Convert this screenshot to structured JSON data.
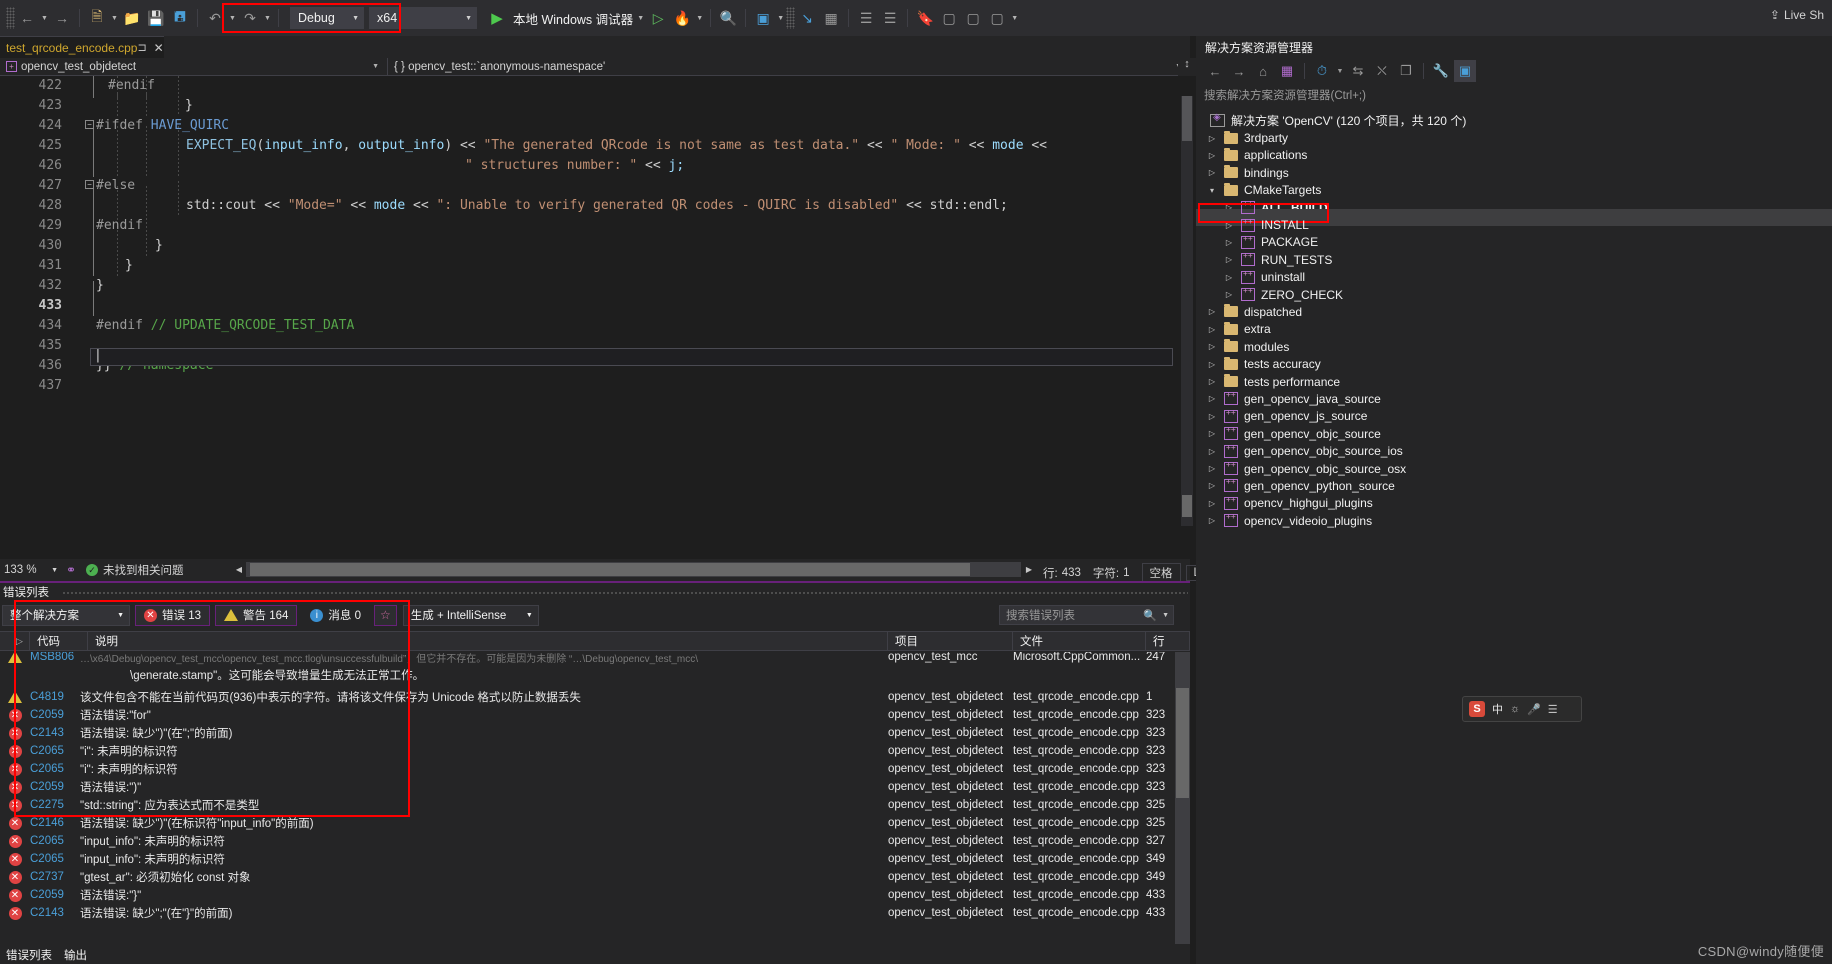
{
  "toolbar": {
    "config": "Debug",
    "platform": "x64",
    "debugger_label": "本地 Windows 调试器",
    "live_share": "Live Sh",
    "icons": [
      "back-icon",
      "forward-icon",
      "new-item-icon",
      "open-file-icon",
      "save-icon",
      "save-all-icon",
      "undo-icon",
      "redo-icon",
      "start-icon",
      "attach-icon",
      "hot-reload-icon",
      "solution-config-icon",
      "window-layout-icon",
      "find-in-files-icon",
      "comment-icon",
      "uncomment-icon",
      "bookmark-icon",
      "prev-bookmark-icon",
      "next-bookmark-icon",
      "clear-bookmarks-icon"
    ]
  },
  "tab": {
    "title": "test_qrcode_encode.cpp",
    "pin": "⊐",
    "close": "✕"
  },
  "navbar": {
    "left": "opencv_test_objdetect",
    "right": "{ } opencv_test::`anonymous-namespace'"
  },
  "editor": {
    "lines": [
      {
        "n": "422",
        "indent": 0
      },
      {
        "n": "423",
        "indent": 0
      },
      {
        "n": "424",
        "indent": 0
      },
      {
        "n": "425",
        "indent": 0
      },
      {
        "n": "426",
        "indent": 0
      },
      {
        "n": "427",
        "indent": 0
      },
      {
        "n": "428",
        "indent": 0
      },
      {
        "n": "429",
        "indent": 0
      },
      {
        "n": "430",
        "indent": 0
      },
      {
        "n": "431",
        "indent": 0
      },
      {
        "n": "432",
        "indent": 0
      },
      {
        "n": "433",
        "indent": 0
      },
      {
        "n": "434",
        "indent": 0
      },
      {
        "n": "435",
        "indent": 0
      },
      {
        "n": "436",
        "indent": 0
      },
      {
        "n": "437",
        "indent": 0
      }
    ],
    "code": {
      "l422": "#endif",
      "l423": "}",
      "l424_kw": "#ifdef",
      "l424_macro": "HAVE_QUIRC",
      "l425_fn": "EXPECT_EQ",
      "l425_a": "(",
      "l425_id1": "input_info",
      "l425_sep": ", ",
      "l425_id2": "output_info",
      "l425_b": ") << ",
      "l425_str": "\"The generated QRcode is not same as test data.\"",
      "l425_c": " << ",
      "l425_str2": "\" Mode: \"",
      "l425_d": " << ",
      "l425_id3": "mode",
      "l425_e": " << ",
      "l426_str": "\" structures number: \"",
      "l426_op": " << ",
      "l426_id": "j;",
      "l427": "#else",
      "l428_a": "std::cout << ",
      "l428_str1": "\"Mode=\"",
      "l428_b": " << ",
      "l428_id": "mode",
      "l428_c": " << ",
      "l428_str2": "\": Unable to verify generated QR codes - QUIRC is disabled\"",
      "l428_d": " << std::endl;",
      "l429": "#endif",
      "l430": "}",
      "l431": "}",
      "l432": "}",
      "l434_kw": "#endif",
      "l434_cmt": "// UPDATE_QRCODE_TEST_DATA",
      "l436_br": "}}",
      "l436_cmt": "// namespace"
    }
  },
  "statusbar": {
    "zoom": "133 %",
    "issues": "未找到相关问题",
    "line_label": "行:",
    "line_value": "433",
    "char_label": "字符:",
    "char_value": "1",
    "spaces": "空格",
    "eol": "LF"
  },
  "error_list": {
    "title": "错误列表",
    "scope": "整个解决方案",
    "errors_label": "错误 13",
    "warnings_label": "警告 164",
    "messages_label": "消息 0",
    "build_filter": "生成 + IntelliSense",
    "search_placeholder": "搜索错误列表",
    "columns": [
      "代码",
      "说明",
      "项目",
      "文件",
      "行"
    ],
    "bottom_tabs": [
      "错误列表",
      "输出"
    ],
    "rows": [
      {
        "sev": "warn",
        "code": "MSB806",
        "desc": "\\generate.stamp\"。这可能会导致增量生成无法正常工作。",
        "project": "opencv_test_mcc",
        "file": "Microsoft.CppCommon...",
        "line": "247",
        "two_line": true
      },
      {
        "sev": "warn",
        "code": "C4819",
        "desc": "该文件包含不能在当前代码页(936)中表示的字符。请将该文件保存为 Unicode 格式以防止数据丢失",
        "project": "opencv_test_objdetect",
        "file": "test_qrcode_encode.cpp",
        "line": "1"
      },
      {
        "sev": "err",
        "code": "C2059",
        "desc": "语法错误:\"for\"",
        "project": "opencv_test_objdetect",
        "file": "test_qrcode_encode.cpp",
        "line": "323"
      },
      {
        "sev": "err",
        "code": "C2143",
        "desc": "语法错误: 缺少\")\"(在\";\"的前面)",
        "project": "opencv_test_objdetect",
        "file": "test_qrcode_encode.cpp",
        "line": "323"
      },
      {
        "sev": "err",
        "code": "C2065",
        "desc": "\"i\": 未声明的标识符",
        "project": "opencv_test_objdetect",
        "file": "test_qrcode_encode.cpp",
        "line": "323"
      },
      {
        "sev": "err",
        "code": "C2065",
        "desc": "\"i\": 未声明的标识符",
        "project": "opencv_test_objdetect",
        "file": "test_qrcode_encode.cpp",
        "line": "323"
      },
      {
        "sev": "err",
        "code": "C2059",
        "desc": "语法错误:\")\"",
        "project": "opencv_test_objdetect",
        "file": "test_qrcode_encode.cpp",
        "line": "323"
      },
      {
        "sev": "err",
        "code": "C2275",
        "desc": "\"std::string\": 应为表达式而不是类型",
        "project": "opencv_test_objdetect",
        "file": "test_qrcode_encode.cpp",
        "line": "325"
      },
      {
        "sev": "err",
        "code": "C2146",
        "desc": "语法错误: 缺少\")\"(在标识符\"input_info\"的前面)",
        "project": "opencv_test_objdetect",
        "file": "test_qrcode_encode.cpp",
        "line": "325"
      },
      {
        "sev": "err",
        "code": "C2065",
        "desc": "\"input_info\": 未声明的标识符",
        "project": "opencv_test_objdetect",
        "file": "test_qrcode_encode.cpp",
        "line": "327"
      },
      {
        "sev": "err",
        "code": "C2065",
        "desc": "\"input_info\": 未声明的标识符",
        "project": "opencv_test_objdetect",
        "file": "test_qrcode_encode.cpp",
        "line": "349"
      },
      {
        "sev": "err",
        "code": "C2737",
        "desc": "\"gtest_ar\": 必须初始化 const 对象",
        "project": "opencv_test_objdetect",
        "file": "test_qrcode_encode.cpp",
        "line": "349"
      },
      {
        "sev": "err",
        "code": "C2059",
        "desc": "语法错误:\"}\"",
        "project": "opencv_test_objdetect",
        "file": "test_qrcode_encode.cpp",
        "line": "433"
      },
      {
        "sev": "err",
        "code": "C2143",
        "desc": "语法错误: 缺少\";\"(在\"}\"的前面)",
        "project": "opencv_test_objdetect",
        "file": "test_qrcode_encode.cpp",
        "line": "433"
      }
    ]
  },
  "solution_explorer": {
    "title": "解决方案资源管理器",
    "search_placeholder": "搜索解决方案资源管理器(Ctrl+;)",
    "root": "解决方案 'OpenCV' (120 个项目，共 120 个)",
    "icons": [
      "back-icon",
      "forward-icon",
      "home-icon",
      "solution-icon",
      "pending-changes-icon",
      "sync-icon",
      "collapse-all-icon",
      "show-all-files-icon",
      "properties-icon",
      "preview-icon"
    ],
    "tree": [
      {
        "label": "3rdparty",
        "type": "folder",
        "depth": 1,
        "expanded": false
      },
      {
        "label": "applications",
        "type": "folder",
        "depth": 1,
        "expanded": false
      },
      {
        "label": "bindings",
        "type": "folder",
        "depth": 1,
        "expanded": false
      },
      {
        "label": "CMakeTargets",
        "type": "folder",
        "depth": 1,
        "expanded": true
      },
      {
        "label": "ALL_BUILD",
        "type": "cpp",
        "depth": 2,
        "expanded": false,
        "bold": true
      },
      {
        "label": "INSTALL",
        "type": "cpp",
        "depth": 2,
        "expanded": false,
        "selected": true
      },
      {
        "label": "PACKAGE",
        "type": "cpp",
        "depth": 2,
        "expanded": false
      },
      {
        "label": "RUN_TESTS",
        "type": "cpp",
        "depth": 2,
        "expanded": false
      },
      {
        "label": "uninstall",
        "type": "cpp",
        "depth": 2,
        "expanded": false
      },
      {
        "label": "ZERO_CHECK",
        "type": "cpp",
        "depth": 2,
        "expanded": false
      },
      {
        "label": "dispatched",
        "type": "folder",
        "depth": 1,
        "expanded": false
      },
      {
        "label": "extra",
        "type": "folder",
        "depth": 1,
        "expanded": false
      },
      {
        "label": "modules",
        "type": "folder",
        "depth": 1,
        "expanded": false
      },
      {
        "label": "tests accuracy",
        "type": "folder",
        "depth": 1,
        "expanded": false
      },
      {
        "label": "tests performance",
        "type": "folder",
        "depth": 1,
        "expanded": false
      },
      {
        "label": "gen_opencv_java_source",
        "type": "cpp",
        "depth": 1,
        "expanded": false
      },
      {
        "label": "gen_opencv_js_source",
        "type": "cpp",
        "depth": 1,
        "expanded": false
      },
      {
        "label": "gen_opencv_objc_source",
        "type": "cpp",
        "depth": 1,
        "expanded": false
      },
      {
        "label": "gen_opencv_objc_source_ios",
        "type": "cpp",
        "depth": 1,
        "expanded": false
      },
      {
        "label": "gen_opencv_objc_source_osx",
        "type": "cpp",
        "depth": 1,
        "expanded": false
      },
      {
        "label": "gen_opencv_python_source",
        "type": "cpp",
        "depth": 1,
        "expanded": false
      },
      {
        "label": "opencv_highgui_plugins",
        "type": "cpp",
        "depth": 1,
        "expanded": false
      },
      {
        "label": "opencv_videoio_plugins",
        "type": "cpp",
        "depth": 1,
        "expanded": false
      }
    ]
  },
  "ime": {
    "lang": "中",
    "s_logo": "S"
  },
  "watermark": "CSDN@windy随便便"
}
